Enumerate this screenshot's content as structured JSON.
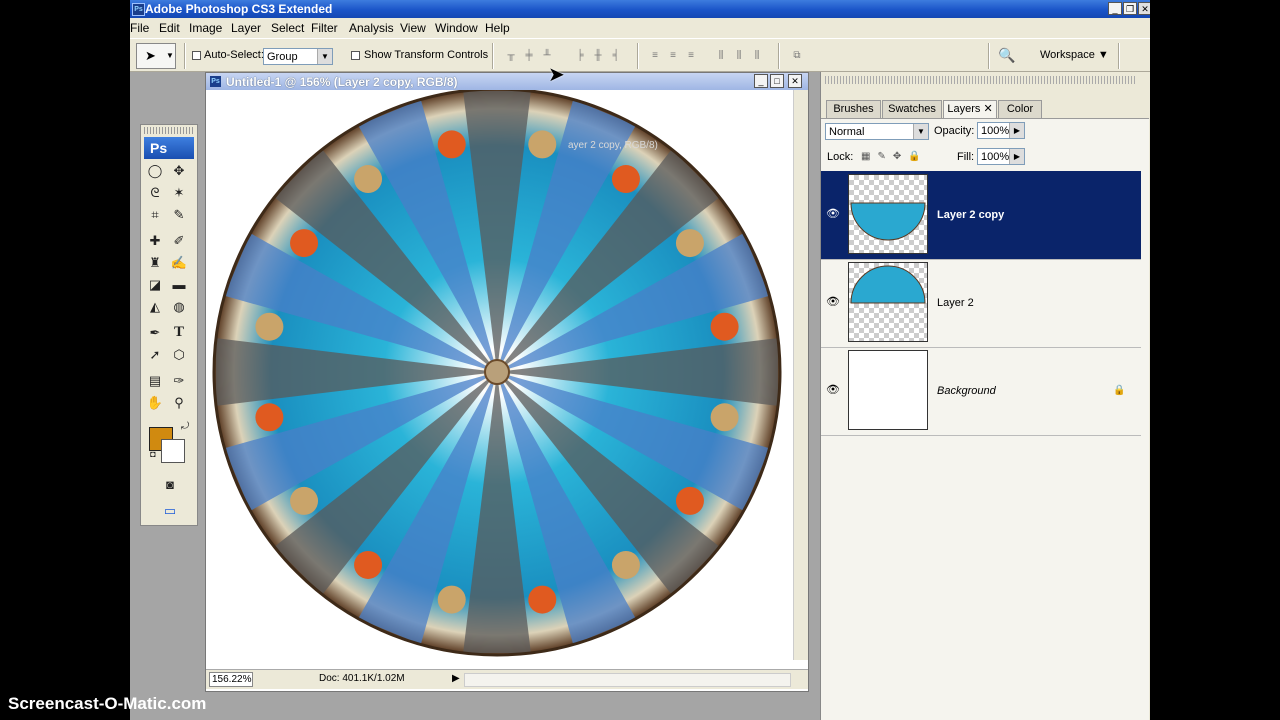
{
  "window": {
    "title": "Adobe Photoshop CS3 Extended"
  },
  "menu": [
    "File",
    "Edit",
    "Image",
    "Layer",
    "Select",
    "Filter",
    "Analysis",
    "View",
    "Window",
    "Help"
  ],
  "options": {
    "auto_select_label": "Auto-Select:",
    "auto_select_value": "Group",
    "show_transform_label": "Show Transform Controls",
    "workspace_label": "Workspace"
  },
  "document": {
    "title": "Untitled-1 @ 156% (Layer 2 copy, RGB/8)",
    "ghost_label": "ayer 2 copy, RGB/8)",
    "zoom": "156.22%",
    "doc_info": "Doc: 401.1K/1.02M"
  },
  "toolbox": {
    "logo": "Ps"
  },
  "layers_panel": {
    "tabs": [
      "Brushes",
      "Swatches",
      "Layers",
      "Color"
    ],
    "active_tab": "Layers",
    "blend_mode": "Normal",
    "opacity_label": "Opacity:",
    "opacity": "100%",
    "lock_label": "Lock:",
    "fill_label": "Fill:",
    "fill": "100%",
    "layers": [
      {
        "name": "Layer 2 copy",
        "selected": true
      },
      {
        "name": "Layer 2",
        "selected": false
      },
      {
        "name": "Background",
        "selected": false
      }
    ]
  },
  "colors": {
    "foreground": "#d08a10",
    "background": "#ffffff",
    "selection": "#0a246a"
  },
  "watermark": "Screencast-O-Matic.com"
}
